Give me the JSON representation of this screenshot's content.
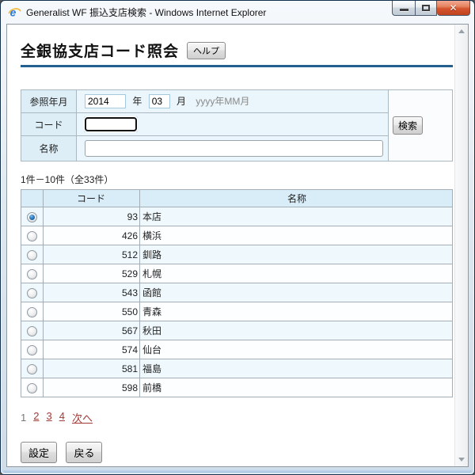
{
  "window": {
    "title": "Generalist WF 振込支店検索 - Windows Internet Explorer",
    "icons": {
      "app": "ie-logo-icon",
      "minimize": "minimize-icon",
      "maximize": "maximize-icon",
      "close": "close-icon"
    }
  },
  "page": {
    "heading": "全銀協支店コード照会",
    "help_label": "ヘルプ"
  },
  "form": {
    "ref_label": "参照年月",
    "year_value": "2014",
    "year_unit": "年",
    "month_value": "03",
    "month_unit": "月",
    "format_hint": "yyyy年MM月",
    "code_label": "コード",
    "code_value": "",
    "name_label": "名称",
    "name_value": "",
    "search_label": "検索"
  },
  "results": {
    "summary": "1件－10件（全33件）",
    "columns": {
      "code": "コード",
      "name": "名称"
    },
    "rows": [
      {
        "code": "93",
        "name": "本店",
        "selected": true
      },
      {
        "code": "426",
        "name": "横浜",
        "selected": false
      },
      {
        "code": "512",
        "name": "釧路",
        "selected": false
      },
      {
        "code": "529",
        "name": "札幌",
        "selected": false
      },
      {
        "code": "543",
        "name": "函館",
        "selected": false
      },
      {
        "code": "550",
        "name": "青森",
        "selected": false
      },
      {
        "code": "567",
        "name": "秋田",
        "selected": false
      },
      {
        "code": "574",
        "name": "仙台",
        "selected": false
      },
      {
        "code": "581",
        "name": "福島",
        "selected": false
      },
      {
        "code": "598",
        "name": "前橋",
        "selected": false
      }
    ]
  },
  "pagination": {
    "current": "1",
    "links": [
      "2",
      "3",
      "4",
      "次へ"
    ]
  },
  "actions": {
    "set_label": "設定",
    "back_label": "戻る"
  },
  "colors": {
    "accent_rule": "#23608f",
    "header_bg": "#d9edf8",
    "label_bg": "#ddeef7",
    "value_bg": "#eaf6fb",
    "link": "#a23a35",
    "close_button": "#d4542e"
  }
}
